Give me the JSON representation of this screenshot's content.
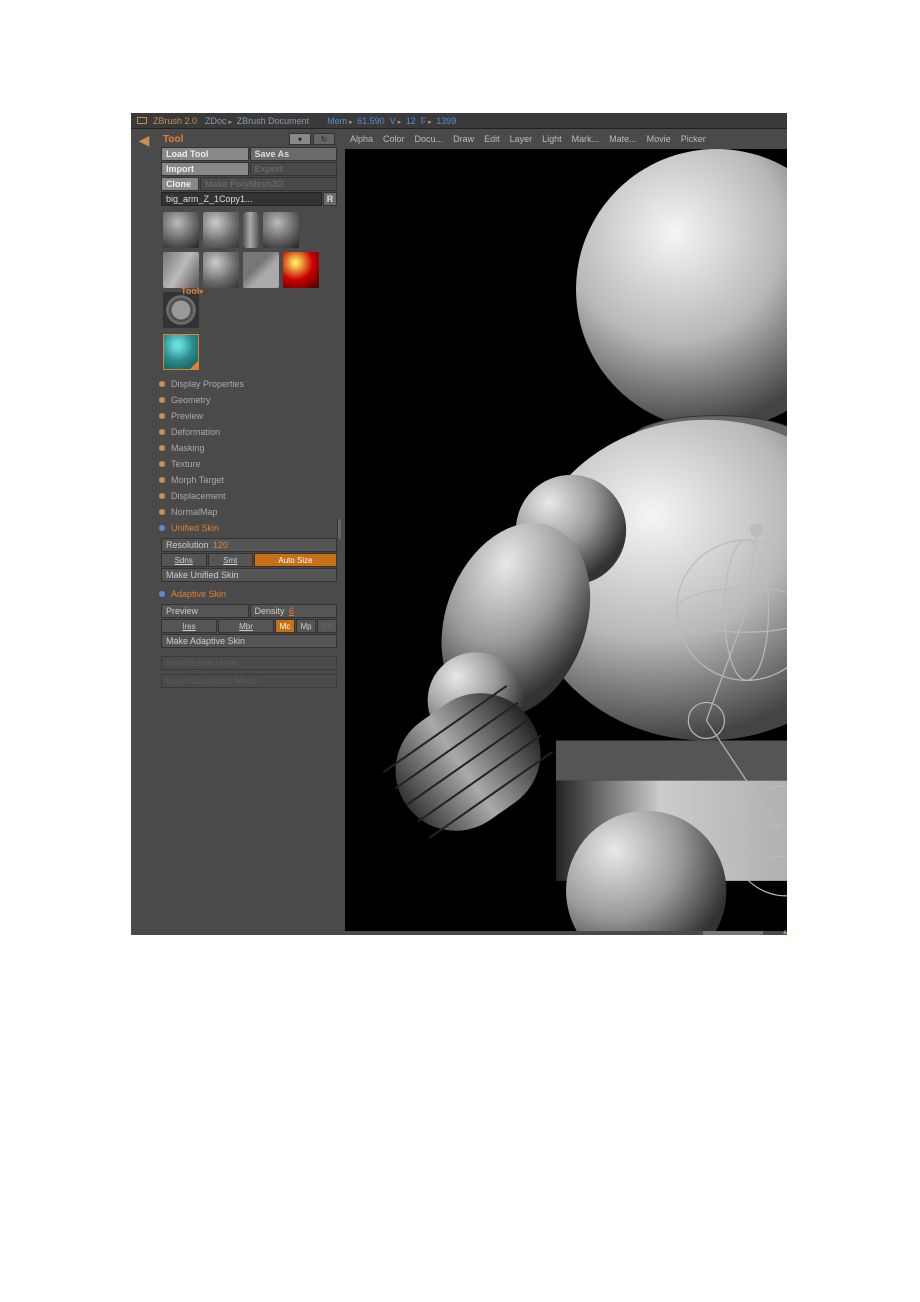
{
  "titlebar": {
    "app": "ZBrush 2.0",
    "doc_label": "ZDoc",
    "doc_name": "ZBrush Document",
    "mem_label": "Mem",
    "mem_value": "61.590",
    "v_label": "V",
    "v_value": "12",
    "f_label": "F",
    "f_value": "1399"
  },
  "menu": {
    "items": [
      "Alpha",
      "Color",
      "Docu...",
      "Draw",
      "Edit",
      "Layer",
      "Light",
      "Mark...",
      "Mate...",
      "Movie",
      "Picker"
    ]
  },
  "tool_panel": {
    "title": "Tool",
    "load_tool": "Load Tool",
    "save_as": "Save As",
    "import": "Import",
    "export": "Export",
    "clone": "Clone",
    "make_polymesh": "Make PolyMesh3D",
    "r_btn": "R",
    "tool_name": "big_arm_Z_1Copy1...",
    "flyout_label": "Tool",
    "subpanels": [
      {
        "key": "display",
        "label": "Display Properties",
        "active": false
      },
      {
        "key": "geometry",
        "label": "Geometry",
        "active": false
      },
      {
        "key": "preview",
        "label": "Preview",
        "active": false
      },
      {
        "key": "deformation",
        "label": "Deformation",
        "active": false
      },
      {
        "key": "masking",
        "label": "Masking",
        "active": false
      },
      {
        "key": "texture",
        "label": "Texture",
        "active": false
      },
      {
        "key": "morph",
        "label": "Morph Target",
        "active": false
      },
      {
        "key": "displacement",
        "label": "Displacement",
        "active": false
      },
      {
        "key": "normalmap",
        "label": "NormalMap",
        "active": false
      },
      {
        "key": "unified",
        "label": "Unified Skin",
        "active": true
      },
      {
        "key": "adaptive",
        "label": "Adaptive Skin",
        "active": true
      }
    ],
    "unified": {
      "resolution_label": "Resolution",
      "resolution_value": "120",
      "sdns": "Sdns",
      "smt": "Smt",
      "auto_size": "Auto Size",
      "make": "Make Unified Skin"
    },
    "adaptive": {
      "preview": "Preview",
      "density_label": "Density",
      "density_value": "6",
      "ires": "Ires",
      "mbr": "Mbr",
      "mc": "Mc",
      "mp": "Mp",
      "pd": "Pd",
      "make": "Make Adaptive Skin"
    },
    "insert_local": "Insert Local Mesh",
    "insert_connector": "Insert Connector Mesh"
  }
}
